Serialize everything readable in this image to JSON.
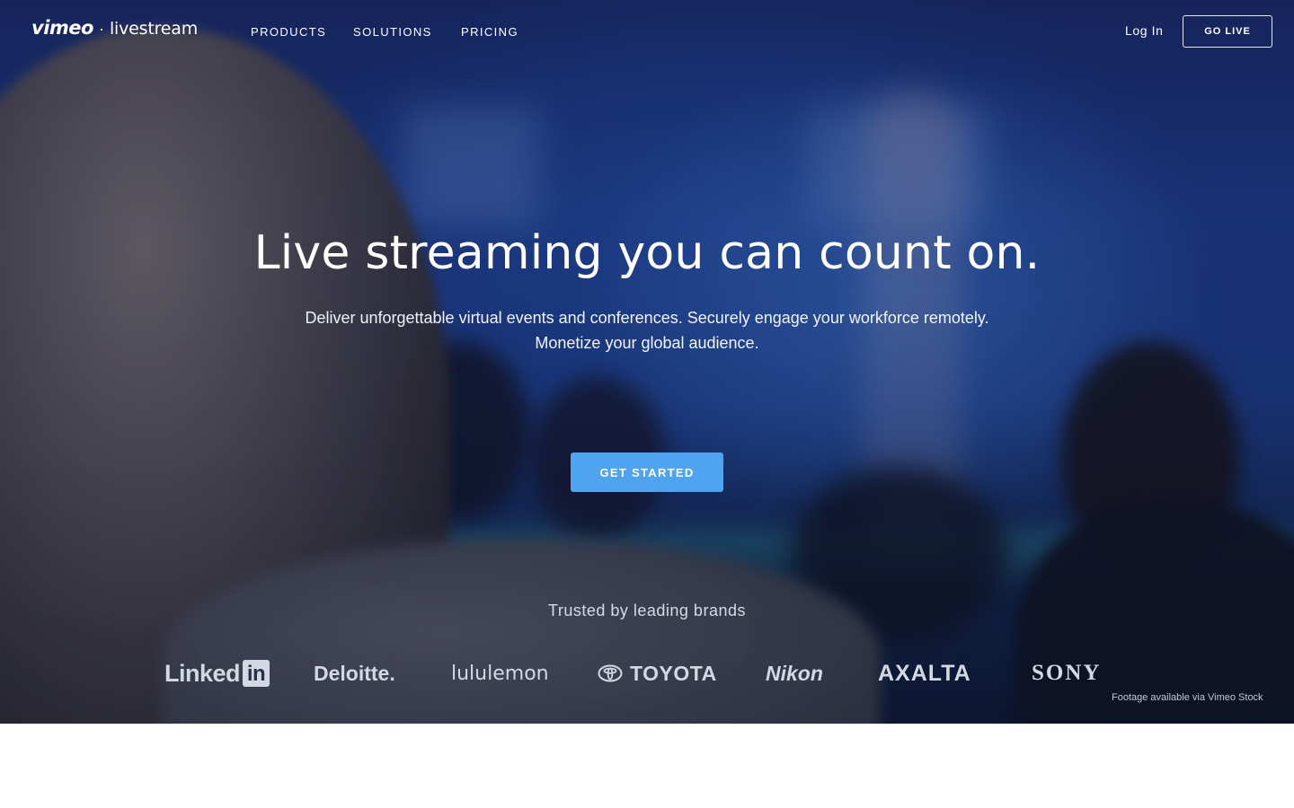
{
  "nav": {
    "logo_primary": "vimeo",
    "logo_separator": "·",
    "logo_secondary": "livestream",
    "links": [
      "PRODUCTS",
      "SOLUTIONS",
      "PRICING"
    ],
    "login": "Log In",
    "cta": "GO LIVE"
  },
  "hero": {
    "headline": "Live streaming you can count on.",
    "subline_1": "Deliver unforgettable virtual events and conferences. Securely engage your workforce remotely.",
    "subline_2": "Monetize your global audience.",
    "cta": "GET STARTED",
    "trusted": "Trusted by leading brands",
    "brands": [
      "Linked",
      "in",
      "Deloitte.",
      "lululemon",
      "TOYOTA",
      "Nikon",
      "AXALTA",
      "SONY"
    ],
    "credit": "Footage available via Vimeo Stock"
  },
  "colors": {
    "cta_blue": "#4fa3ef",
    "hero_blue": "#213f93",
    "text_white": "#ffffff"
  },
  "icons": [
    "toyota-logo-icon",
    "linkedin-logo-icon"
  ]
}
